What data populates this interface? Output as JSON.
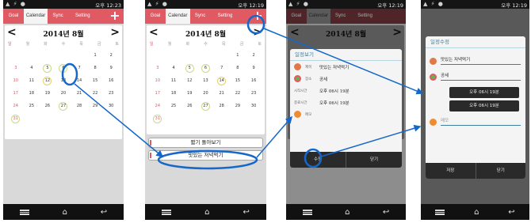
{
  "statusbar": {
    "icons": "▲ ⚡ ●",
    "time_p1": "오후 12:23",
    "time_p2": "오후 12:19",
    "time_p3": "오후 12:19",
    "time_p4": "오후 12:19"
  },
  "tabs": [
    "Goal",
    "Calendar",
    "Sync",
    "Setting"
  ],
  "add_label": "+",
  "calendar": {
    "month_title": "2014년 8월",
    "prev": "<",
    "next": ">",
    "weekdays": [
      "일",
      "월",
      "화",
      "수",
      "목",
      "금",
      "토"
    ],
    "weeks": [
      [
        "",
        "",
        "",
        "",
        "",
        "1",
        "2"
      ],
      [
        "3",
        "4",
        "5",
        "6",
        "7",
        "8",
        "9"
      ],
      [
        "10",
        "11",
        "12",
        "13",
        "14",
        "15",
        "16"
      ],
      [
        "17",
        "18",
        "19",
        "20",
        "21",
        "22",
        "23"
      ],
      [
        "24",
        "25",
        "26",
        "27",
        "28",
        "29",
        "30"
      ],
      [
        "31",
        "",
        "",
        "",
        "",
        "",
        ""
      ]
    ]
  },
  "events": [
    "짧기 돌아보기",
    "맛있는 저녁먹기"
  ],
  "view_dialog": {
    "title": "일정보기",
    "rows": [
      {
        "label": "제목",
        "value": "맛있는 저녁먹기",
        "icon": "event-icon"
      },
      {
        "label": "장소",
        "value": "공세",
        "icon": "place-icon"
      },
      {
        "label": "시작시간",
        "value": "오후 06시 19분",
        "icon": ""
      },
      {
        "label": "종료시간",
        "value": "오후 06시 19분",
        "icon": ""
      },
      {
        "label": "메모",
        "value": "",
        "icon": "memo-icon"
      }
    ],
    "buttons": [
      "수정",
      "닫기"
    ]
  },
  "edit_dialog": {
    "title": "일정수정",
    "title_value": "맛있는 저녁먹기",
    "place_value": "공세",
    "start_time": "오후 06시 19분",
    "end_time": "오후 06시 19분",
    "memo_placeholder": "메모",
    "buttons": [
      "저장",
      "닫기"
    ]
  },
  "colors": {
    "accent": "#e05a64",
    "dialog_title": "#3e7f9c",
    "annotation": "#1568c9"
  }
}
